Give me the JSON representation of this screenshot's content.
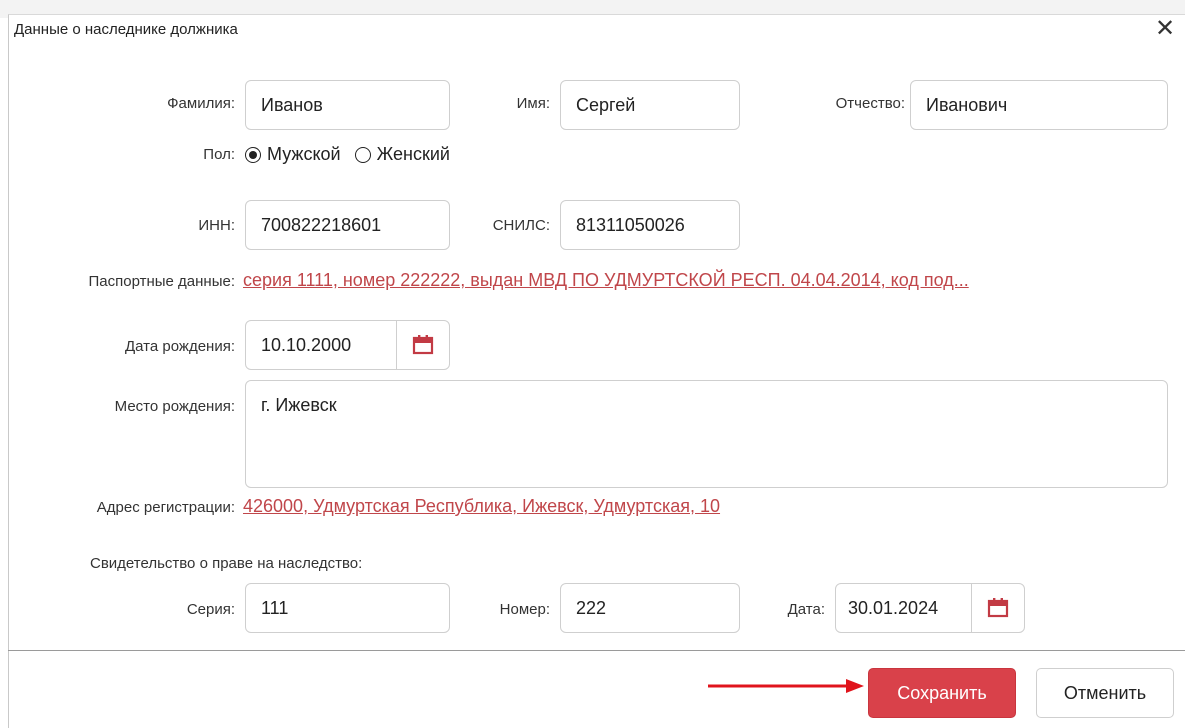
{
  "dialog": {
    "title": "Данные о наследнике должника"
  },
  "labels": {
    "surname": "Фамилия:",
    "name": "Имя:",
    "patronymic": "Отчество:",
    "gender": "Пол:",
    "inn": "ИНН:",
    "snils": "СНИЛС:",
    "passport": "Паспортные данные:",
    "birth_date": "Дата рождения:",
    "birth_place": "Место рождения:",
    "address": "Адрес регистрации:",
    "certificate": "Свидетельство о праве на наследство:",
    "series": "Серия:",
    "number": "Номер:",
    "date": "Дата:"
  },
  "values": {
    "surname": "Иванов",
    "name": "Сергей",
    "patronymic": "Иванович",
    "inn": "700822218601",
    "snils": "81311050026",
    "passport": "серия 1111, номер 222222, выдан МВД ПО УДМУРТСКОЙ РЕСП. 04.04.2014, код под...",
    "birth_date": "10.10.2000",
    "birth_place": "г. Ижевск",
    "address": "426000, Удмуртская Республика, Ижевск, Удмуртская, 10",
    "series": "111",
    "number": "222",
    "date": "30.01.2024"
  },
  "gender_options": [
    {
      "label": "Мужской",
      "checked": true
    },
    {
      "label": "Женский",
      "checked": false
    }
  ],
  "buttons": {
    "save": "Сохранить",
    "cancel": "Отменить"
  },
  "colors": {
    "accent": "#d9414a",
    "link": "#c0464a",
    "arrow": "#e0141c"
  },
  "icons": {
    "close": "close-icon",
    "calendar": "calendar-icon",
    "arrow": "arrow-right-icon"
  }
}
